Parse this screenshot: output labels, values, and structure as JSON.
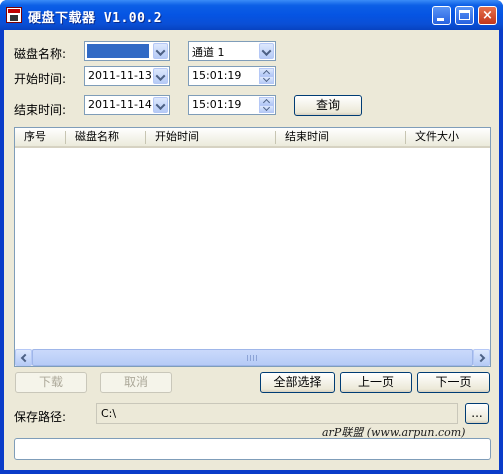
{
  "window": {
    "title": "硬盘下载器 V1.00.2",
    "buttons": {
      "minimize": "minimize",
      "maximize": "maximize",
      "close": "×"
    }
  },
  "filters": {
    "disk_name_label": "磁盘名称:",
    "disk_name_value": "",
    "channel_value": "通道 1",
    "start_time_label": "开始时间:",
    "start_date": "2011-11-13",
    "start_time": "15:01:19",
    "end_time_label": "结束时间:",
    "end_date": "2011-11-14",
    "end_time": "15:01:19",
    "query_button": "查询"
  },
  "table": {
    "columns": [
      "序号",
      "磁盘名称",
      "开始时间",
      "结束时间",
      "文件大小"
    ],
    "rows": []
  },
  "actions": {
    "download": "下载",
    "cancel": "取消",
    "select_all": "全部选择",
    "prev_page": "上一页",
    "next_page": "下一页"
  },
  "save": {
    "label": "保存路径:",
    "path": "C:\\",
    "browse": "..."
  },
  "watermark": "arP联盟 (www.arpun.com)",
  "colors": {
    "titlebar": "#0554e3",
    "face": "#ece9d8",
    "border": "#7f9db9",
    "selection": "#316ac5"
  }
}
